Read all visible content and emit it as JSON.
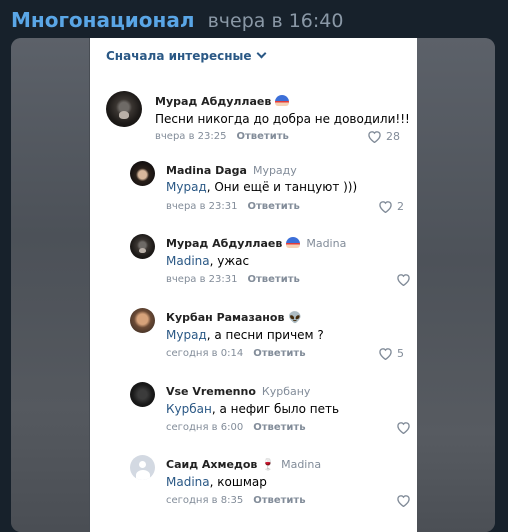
{
  "header": {
    "channel": "Многонационал",
    "time": "вчера в 16:40"
  },
  "card": {
    "sort_label": "Сначала интересные",
    "comments": [
      {
        "name": "Мурад Абдуллаев",
        "badge": "cap",
        "reply_to": "",
        "mention": "",
        "text": "Песни никогда до добра не доводили!!!",
        "time": "вчера в 23:25",
        "reply": "Ответить",
        "likes": "28",
        "avatar": "monkey"
      },
      {
        "name": "Madina Daga",
        "badge": "",
        "reply_to": "Мураду",
        "mention": "Мурад",
        "text": ", Они ещё и танцуют )))",
        "time": "вчера в 23:31",
        "reply": "Ответить",
        "likes": "2",
        "avatar": "hair"
      },
      {
        "name": "Мурад Абдуллаев",
        "badge": "cap",
        "reply_to": "Madina",
        "mention": "Madina",
        "text": ", ужас",
        "time": "вчера в 23:31",
        "reply": "Ответить",
        "likes": "",
        "avatar": "monkey"
      },
      {
        "name": "Курбан Рамазанов",
        "badge": "👽",
        "reply_to": "",
        "mention": "Мурад",
        "text": ", а песни причем ?",
        "time": "сегодня в 0:14",
        "reply": "Ответить",
        "likes": "5",
        "avatar": "man"
      },
      {
        "name": "Vse Vremenno",
        "badge": "",
        "reply_to": "Курбану",
        "mention": "Курбан",
        "text": ", а нефиг было петь",
        "time": "сегодня в 6:00",
        "reply": "Ответить",
        "likes": "",
        "avatar": "dark"
      },
      {
        "name": "Саид Ахмедов",
        "badge": "🍷",
        "reply_to": "Madina",
        "mention": "Madina",
        "text": ", кошмар",
        "time": "сегодня в 8:35",
        "reply": "Ответить",
        "likes": "",
        "avatar": "default"
      }
    ]
  },
  "icons": {
    "heart": "heart-outline-icon",
    "sort": "chevron-down-icon"
  },
  "colors": {
    "channel": "#5aa6e6",
    "link": "#2a5885",
    "muted": "#828c99",
    "background": "#17212b"
  }
}
